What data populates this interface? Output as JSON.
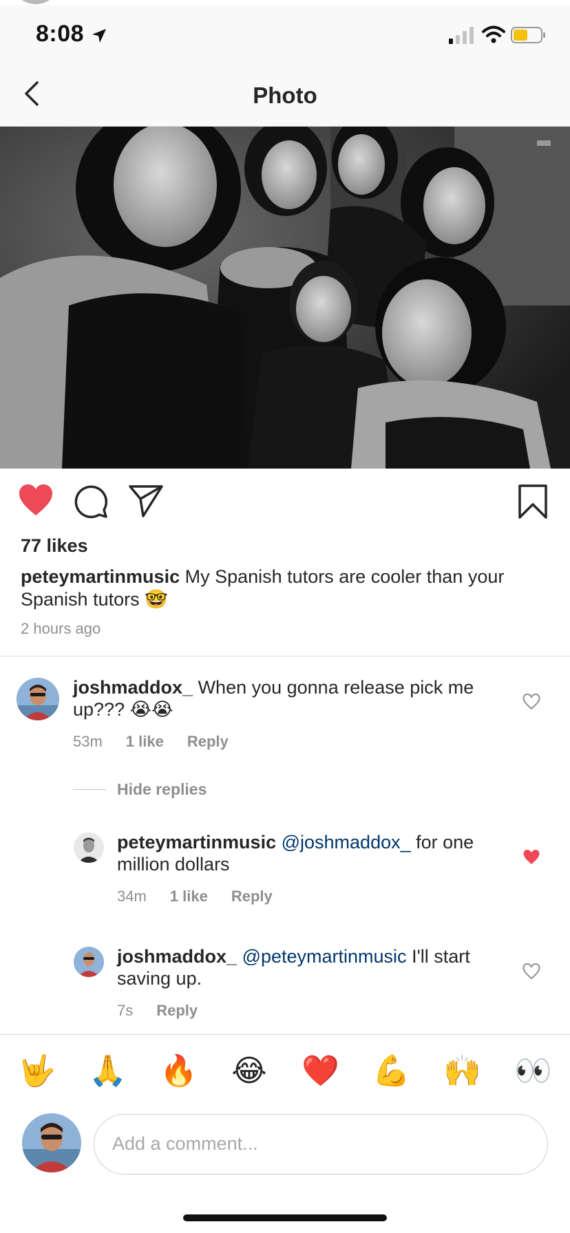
{
  "status_bar": {
    "time": "8:08",
    "icons": [
      "location-arrow-icon",
      "cellular-signal-icon",
      "wifi-icon",
      "battery-icon"
    ],
    "battery_color": "#f4c20d"
  },
  "nav": {
    "title": "Photo",
    "back_icon": "chevron-left-icon"
  },
  "post": {
    "photo_description": "black-and-white group selfie",
    "actions": {
      "liked": true,
      "like_color": "#ed4956",
      "icons": [
        "heart-filled-icon",
        "comment-icon",
        "share-icon",
        "bookmark-icon"
      ]
    },
    "likes_text": "77 likes",
    "caption": {
      "username": "peteymartinmusic",
      "text": "My Spanish tutors are cooler than your Spanish tutors 🤓"
    },
    "time_ago": "2 hours ago"
  },
  "comments": [
    {
      "username": "joshmaddox_",
      "text": "When you gonna release pick me up??? 😭😭",
      "time": "53m",
      "likes": "1 like",
      "reply_label": "Reply",
      "liked": false
    }
  ],
  "hide_replies_label": "Hide replies",
  "replies": [
    {
      "username": "peteymartinmusic",
      "mention": "@joshmaddox_",
      "text": "for one million dollars",
      "time": "34m",
      "likes": "1 like",
      "reply_label": "Reply",
      "liked": true
    },
    {
      "username": "joshmaddox_",
      "mention": "@peteymartinmusic",
      "text": "I'll start saving up.",
      "time": "7s",
      "reply_label": "Reply",
      "liked": false
    }
  ],
  "emoji_bar": [
    "🤟",
    "🙏",
    "🔥",
    "😂",
    "❤️",
    "💪",
    "🙌",
    "👀"
  ],
  "add_comment": {
    "placeholder": "Add a comment..."
  },
  "colors": {
    "mention": "#00376b",
    "secondary_text": "#8e8e8e",
    "like_red": "#ed4956"
  }
}
